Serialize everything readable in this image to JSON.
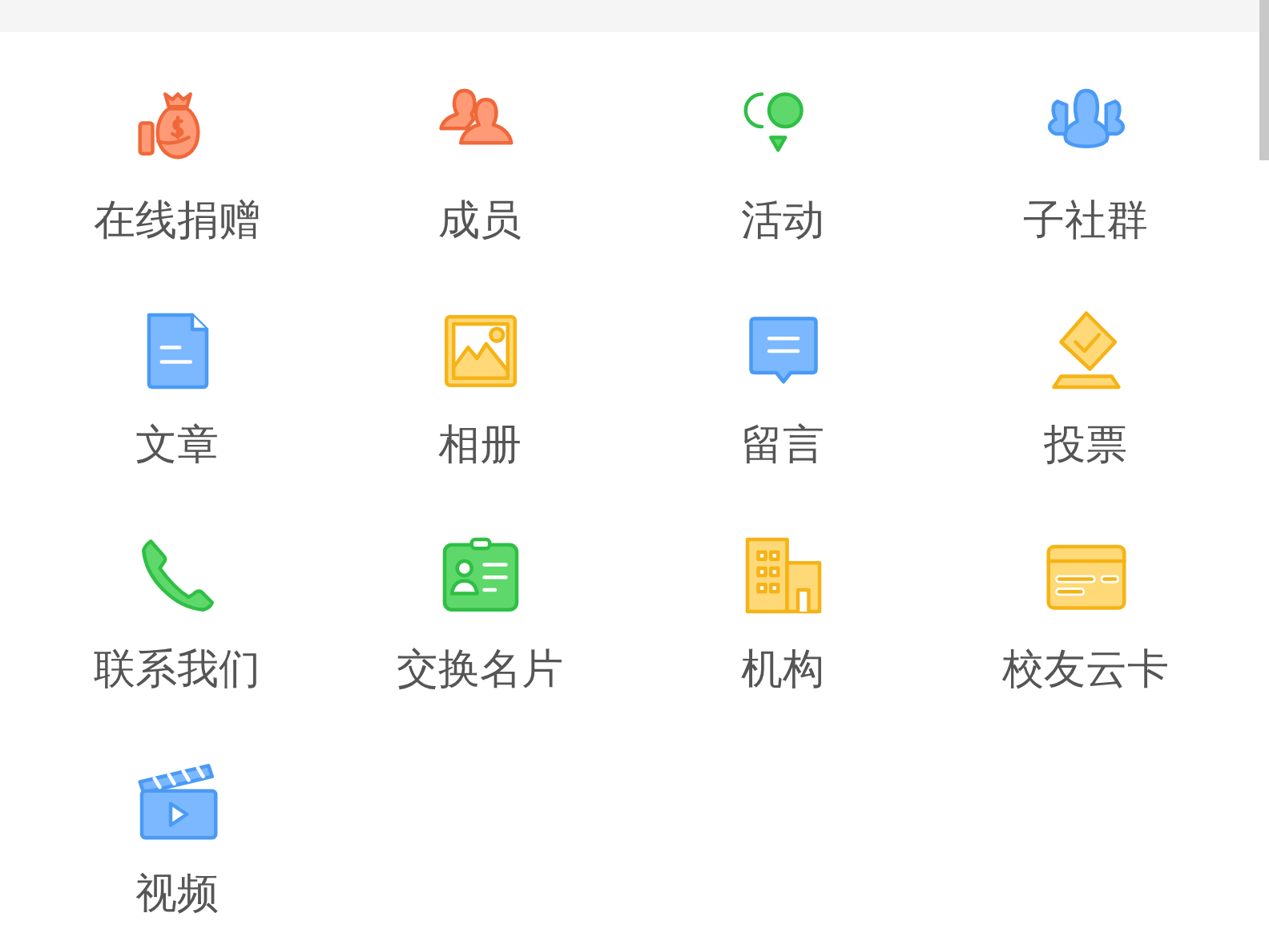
{
  "grid": {
    "items": [
      {
        "label": "在线捐赠"
      },
      {
        "label": "成员"
      },
      {
        "label": "活动"
      },
      {
        "label": "子社群"
      },
      {
        "label": "文章"
      },
      {
        "label": "相册"
      },
      {
        "label": "留言"
      },
      {
        "label": "投票"
      },
      {
        "label": "联系我们"
      },
      {
        "label": "交换名片"
      },
      {
        "label": "机构"
      },
      {
        "label": "校友云卡"
      },
      {
        "label": "视频"
      }
    ]
  }
}
